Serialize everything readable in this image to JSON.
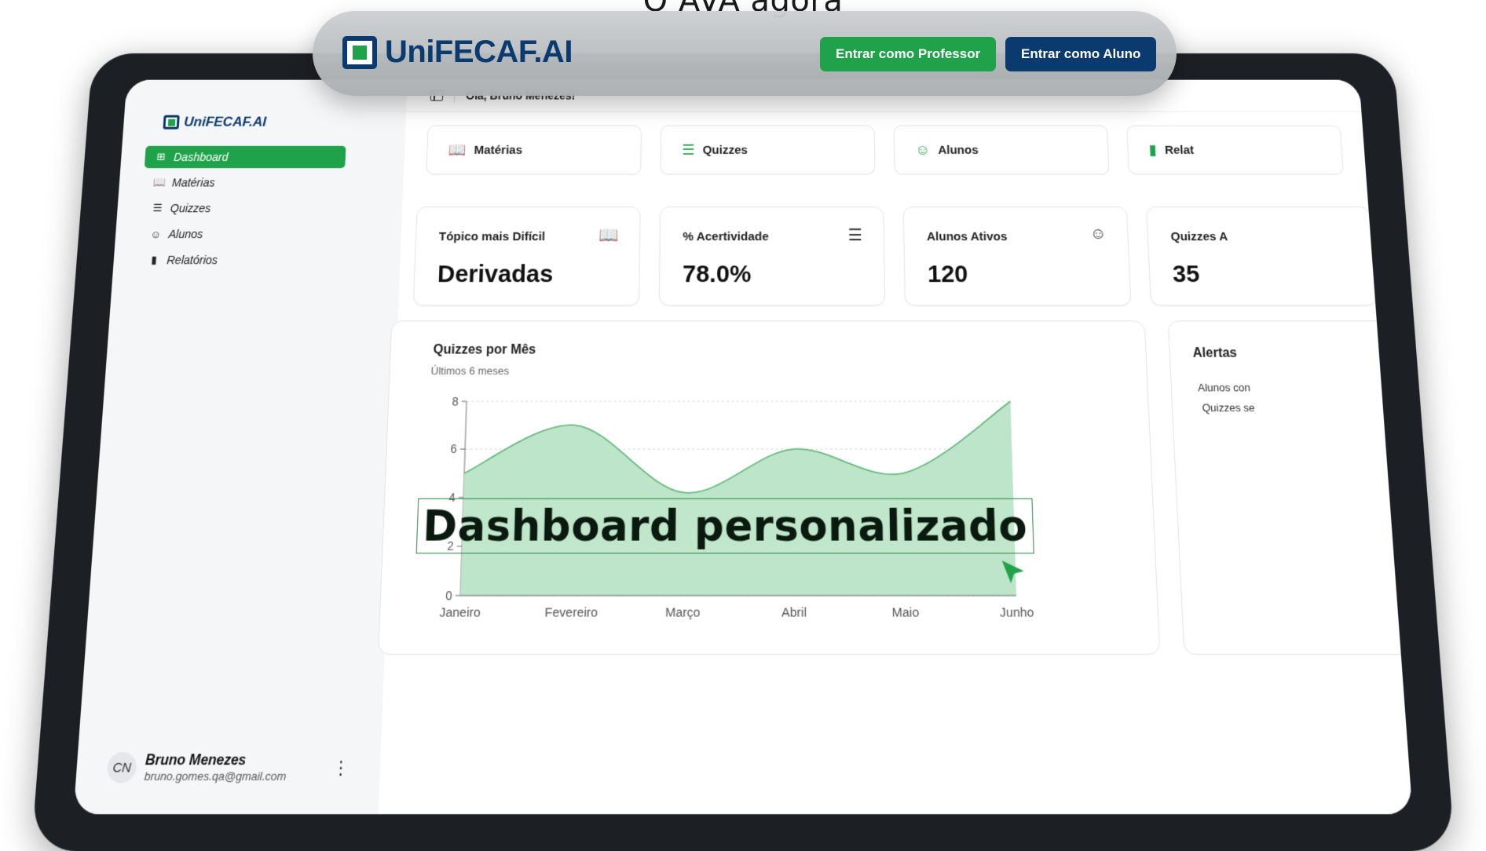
{
  "page_heading": "O AVA agora",
  "header": {
    "brand": "UniFECAF.AI",
    "buttons": {
      "professor": "Entrar como Professor",
      "aluno": "Entrar como Aluno"
    }
  },
  "sidebar": {
    "brand": "UniFECAF.AI",
    "items": [
      {
        "label": "Dashboard",
        "icon": "layout-grid-icon",
        "active": true
      },
      {
        "label": "Matérias",
        "icon": "book-open-icon",
        "active": false
      },
      {
        "label": "Quizzes",
        "icon": "list-checks-icon",
        "active": false
      },
      {
        "label": "Alunos",
        "icon": "users-icon",
        "active": false
      },
      {
        "label": "Relatórios",
        "icon": "bar-chart-icon",
        "active": false
      }
    ],
    "user": {
      "initials": "CN",
      "name": "Bruno Menezes",
      "email": "bruno.gomes.qa@gmail.com"
    }
  },
  "topbar": {
    "greeting": "Olá, Bruno Menezes!"
  },
  "tabs": [
    {
      "label": "Matérias",
      "icon": "book-open-icon"
    },
    {
      "label": "Quizzes",
      "icon": "list-checks-icon"
    },
    {
      "label": "Alunos",
      "icon": "users-icon"
    },
    {
      "label": "Relat",
      "icon": "bar-chart-icon"
    }
  ],
  "stats": [
    {
      "label": "Tópico mais Difícil",
      "value": "Derivadas",
      "icon": "book-open-icon"
    },
    {
      "label": "% Acertividade",
      "value": "78.0%",
      "icon": "list-checks-icon"
    },
    {
      "label": "Alunos Ativos",
      "value": "120",
      "icon": "users-icon"
    },
    {
      "label": "Quizzes A",
      "value": "35",
      "icon": ""
    }
  ],
  "chart_data": {
    "type": "area",
    "title": "Quizzes por Mês",
    "subtitle": "Últimos 6 meses",
    "categories": [
      "Janeiro",
      "Fevereiro",
      "Março",
      "Abril",
      "Maio",
      "Junho"
    ],
    "values": [
      5,
      7,
      4.2,
      6,
      5,
      8
    ],
    "yticks": [
      0,
      2,
      4,
      6,
      8
    ],
    "ylim": [
      0,
      8
    ],
    "color": "#b9e4c6",
    "line_color": "#5cb474",
    "grid": true
  },
  "overlay_caption": "Dashboard personalizado",
  "alerts": {
    "title": "Alertas",
    "lines": [
      "Alunos con",
      "Quizzes se"
    ]
  }
}
